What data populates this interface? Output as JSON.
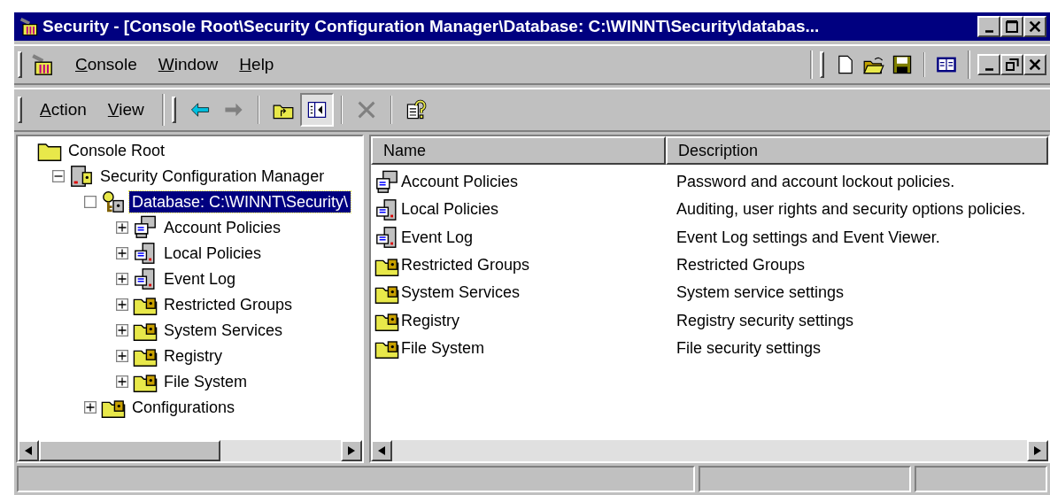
{
  "window": {
    "title": "Security - [Console Root\\Security Configuration Manager\\Database: C:\\WINNT\\Security\\databas..."
  },
  "menu_bar": {
    "items": [
      {
        "label": "Console"
      },
      {
        "label": "Window"
      },
      {
        "label": "Help"
      }
    ],
    "tools": [
      {
        "kind": "new"
      },
      {
        "kind": "open"
      },
      {
        "kind": "save"
      },
      {
        "kind": "separator"
      },
      {
        "kind": "columns"
      }
    ]
  },
  "toolbar": {
    "menus": [
      {
        "label": "Action"
      },
      {
        "label": "View"
      }
    ],
    "buttons": [
      {
        "kind": "back",
        "disabled": false,
        "pressed": false
      },
      {
        "kind": "forward",
        "disabled": true,
        "pressed": false
      },
      {
        "kind": "separator"
      },
      {
        "kind": "up",
        "disabled": false,
        "pressed": false
      },
      {
        "kind": "tree",
        "disabled": false,
        "pressed": true
      },
      {
        "kind": "separator"
      },
      {
        "kind": "delete",
        "disabled": true,
        "pressed": false
      },
      {
        "kind": "separator"
      },
      {
        "kind": "help",
        "disabled": false,
        "pressed": false
      }
    ]
  },
  "tree": [
    {
      "label": "Console Root",
      "kind": "folder",
      "selected": false,
      "children": [
        {
          "label": "Security Configuration Manager",
          "kind": "server-lock",
          "expanded": true,
          "selected": false,
          "children": [
            {
              "label": "Database: C:\\WINNT\\Security\\",
              "kind": "key-lock",
              "selected": true,
              "children": [
                {
                  "label": "Account Policies",
                  "kind": "computers",
                  "expanded": false,
                  "selected": false
                },
                {
                  "label": "Local Policies",
                  "kind": "computer",
                  "expanded": false,
                  "selected": false
                },
                {
                  "label": "Event Log",
                  "kind": "computer",
                  "expanded": false,
                  "selected": false
                },
                {
                  "label": "Restricted Groups",
                  "kind": "folder-lock",
                  "expanded": false,
                  "selected": false
                },
                {
                  "label": "System Services",
                  "kind": "folder-lock",
                  "expanded": false,
                  "selected": false
                },
                {
                  "label": "Registry",
                  "kind": "folder-lock",
                  "expanded": false,
                  "selected": false
                },
                {
                  "label": "File System",
                  "kind": "folder-lock",
                  "expanded": false,
                  "selected": false
                }
              ]
            },
            {
              "label": "Configurations",
              "kind": "folder-lock",
              "expanded": false,
              "selected": false
            }
          ]
        }
      ]
    }
  ],
  "list": {
    "columns": [
      "Name",
      "Description"
    ],
    "rows": [
      {
        "kind": "computers",
        "name": "Account Policies",
        "description": "Password and account lockout policies."
      },
      {
        "kind": "computer",
        "name": "Local Policies",
        "description": "Auditing, user rights and security options policies."
      },
      {
        "kind": "computer",
        "name": "Event Log",
        "description": "Event Log settings and Event Viewer."
      },
      {
        "kind": "folder-lock",
        "name": "Restricted Groups",
        "description": "Restricted Groups"
      },
      {
        "kind": "folder-lock",
        "name": "System Services",
        "description": "System service settings"
      },
      {
        "kind": "folder-lock",
        "name": "Registry",
        "description": "Registry security settings"
      },
      {
        "kind": "folder-lock",
        "name": "File System",
        "description": "File security settings"
      }
    ]
  }
}
